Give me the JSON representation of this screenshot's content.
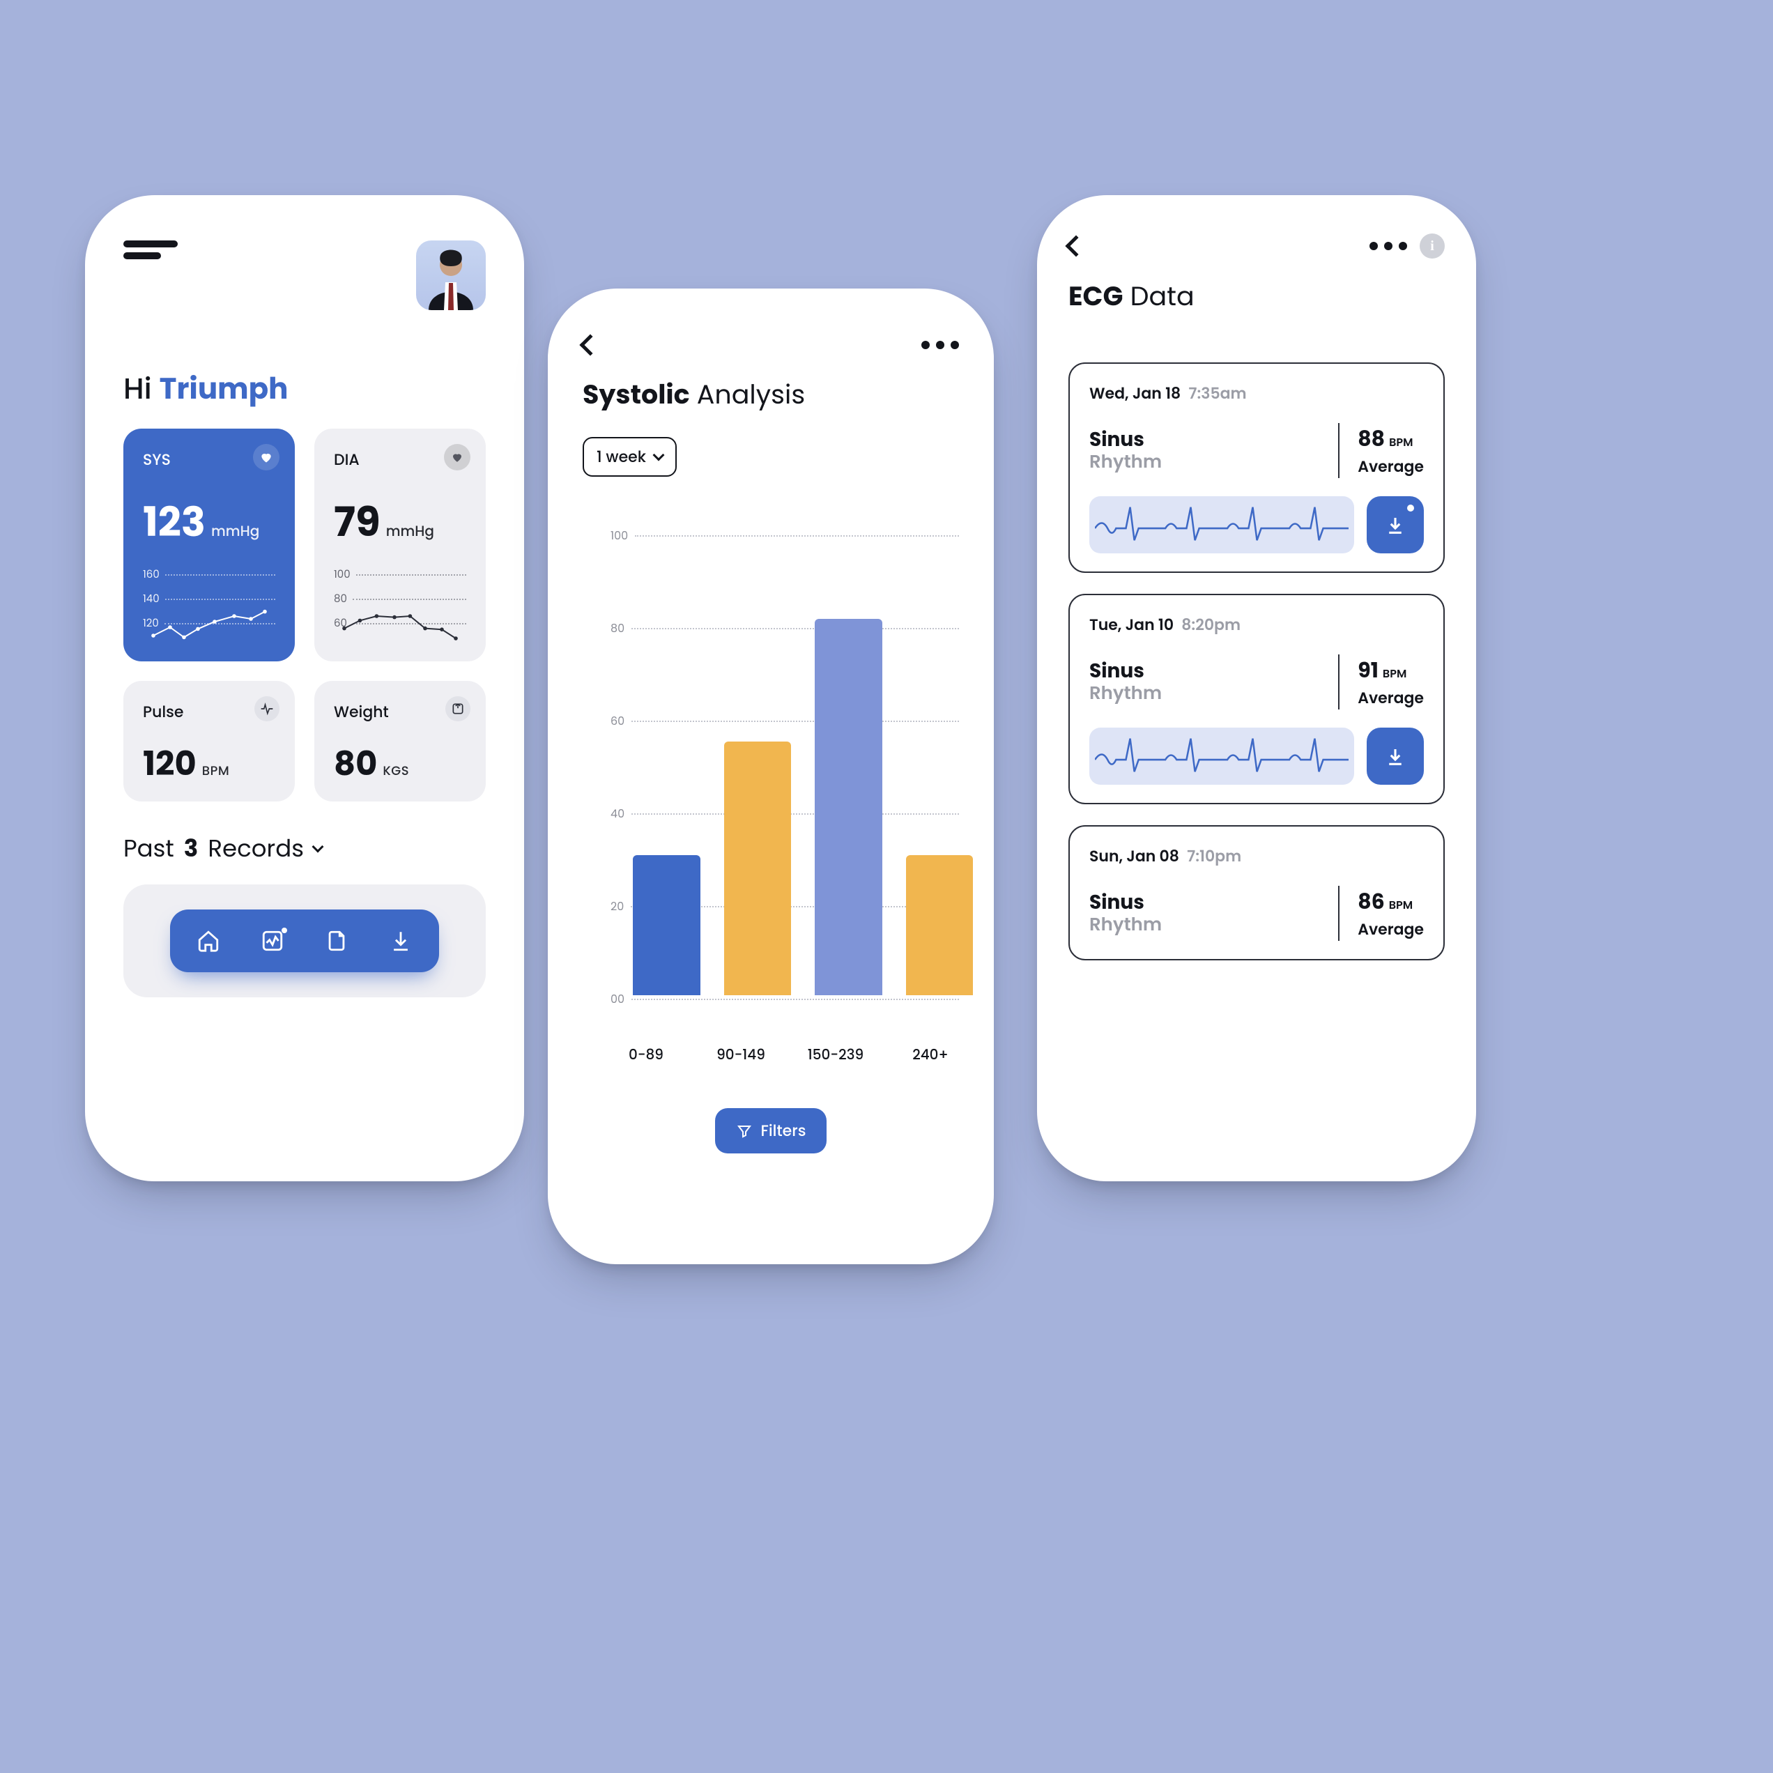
{
  "colors": {
    "primary": "#3e69c6",
    "primary_light": "#7f94d7",
    "accent": "#f1b64f"
  },
  "screen1": {
    "greeting_pre": "Hi ",
    "greeting_name": "Triumph",
    "tiles": {
      "sys": {
        "label": "SYS",
        "value": "123",
        "unit": "mmHg",
        "ticks": [
          "160",
          "140",
          "120"
        ]
      },
      "dia": {
        "label": "DIA",
        "value": "79",
        "unit": "mmHg",
        "ticks": [
          "100",
          "80",
          "60"
        ]
      },
      "pulse": {
        "label": "Pulse",
        "value": "120",
        "unit": "BPM"
      },
      "weight": {
        "label": "Weight",
        "value": "80",
        "unit": "KGS"
      }
    },
    "records": {
      "pre": "Past ",
      "count": "3",
      "post": " Records"
    },
    "nav": [
      "home",
      "vitals",
      "document",
      "download"
    ]
  },
  "screen2": {
    "title_bold": "Systolic",
    "title_rest": " Analysis",
    "range": "1 week",
    "filters_label": "Filters"
  },
  "chart_data": {
    "type": "bar",
    "title": "Systolic Analysis",
    "xlabel": "",
    "ylabel": "",
    "ylim": [
      0,
      100
    ],
    "y_ticks": [
      100,
      80,
      60,
      40,
      20,
      0
    ],
    "categories": [
      "0-89",
      "90-149",
      "150-239",
      "240+"
    ],
    "values": [
      32,
      58,
      86,
      32
    ],
    "bar_colors": [
      "#3e69c6",
      "#f1b64f",
      "#7f94d7",
      "#f1b64f"
    ]
  },
  "screen3": {
    "title_bold": "ECG",
    "title_rest": " Data",
    "items": [
      {
        "day": "Wed, Jan 18",
        "time": "7:35am",
        "t1": "Sinus",
        "t2": "Rhythm",
        "bpm": "88",
        "bpm_unit": "BPM",
        "sub": "Average",
        "dot": true
      },
      {
        "day": "Tue, Jan 10",
        "time": "8:20pm",
        "t1": "Sinus",
        "t2": "Rhythm",
        "bpm": "91",
        "bpm_unit": "BPM",
        "sub": "Average",
        "dot": false
      },
      {
        "day": "Sun, Jan 08",
        "time": "7:10pm",
        "t1": "Sinus",
        "t2": "Rhythm",
        "bpm": "86",
        "bpm_unit": "BPM",
        "sub": "Average",
        "dot": false
      }
    ]
  }
}
